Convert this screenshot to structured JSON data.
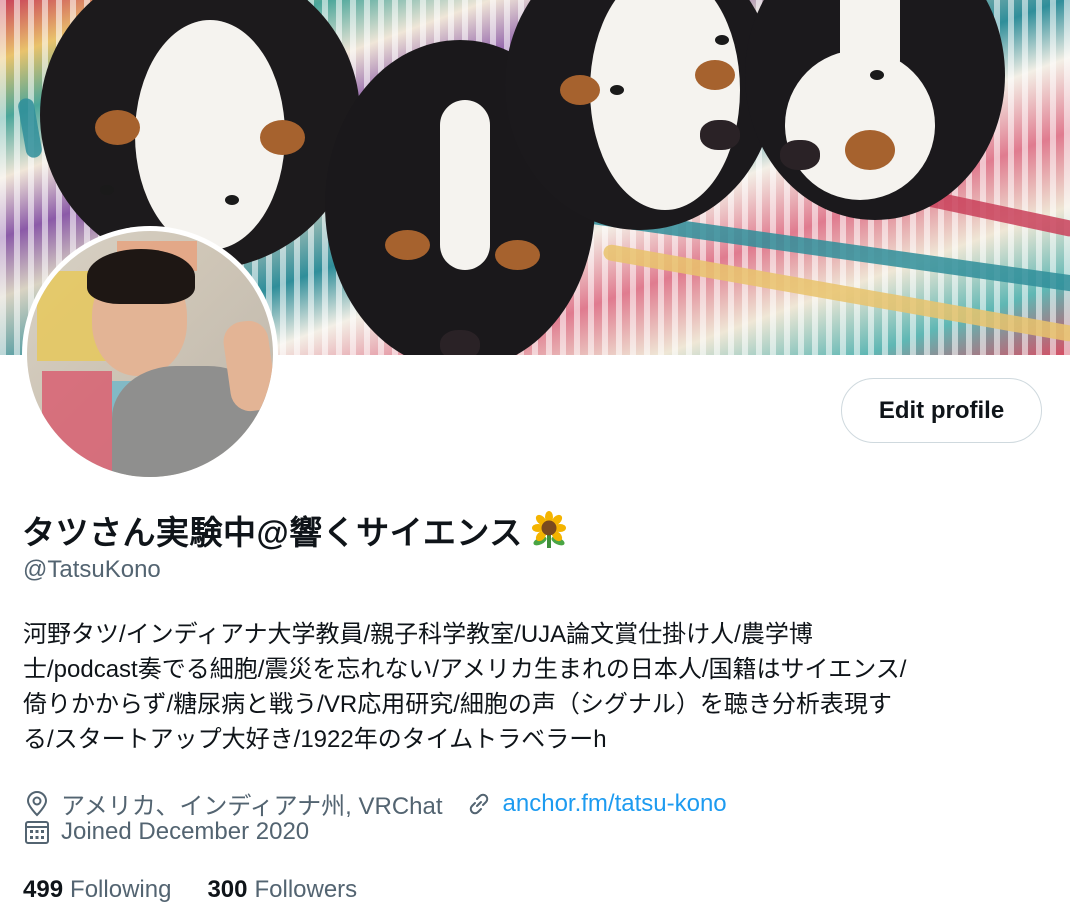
{
  "profile": {
    "display_name": "タツさん実験中@響くサイエンス",
    "name_emoji": "sunflower-icon",
    "handle": "@TatsuKono",
    "bio_lines": [
      "河野タツ/インディアナ大学教員/親子科学教室/UJA論文賞仕掛け人/農学博",
      "士/podcast奏でる細胞/震災を忘れない/アメリカ生まれの日本人/国籍はサイエンス/",
      "倚りかからず/糖尿病と戦う/VR応用研究/細胞の声（シグナル）を聴き分析表現す",
      "る/スタートアップ大好き/1922年のタイムトラベラーh"
    ],
    "location": "アメリカ、インディアナ州, VRChat",
    "website": "anchor.fm/tatsu-kono",
    "joined": "Joined December 2020",
    "following_count": "499",
    "following_label": "Following",
    "followers_count": "300",
    "followers_label": "Followers"
  },
  "actions": {
    "edit_profile_label": "Edit profile"
  },
  "colors": {
    "link": "#1d9bf0",
    "secondary_text": "#536471",
    "primary_text": "#0f1419",
    "button_border": "#cfd9de"
  }
}
